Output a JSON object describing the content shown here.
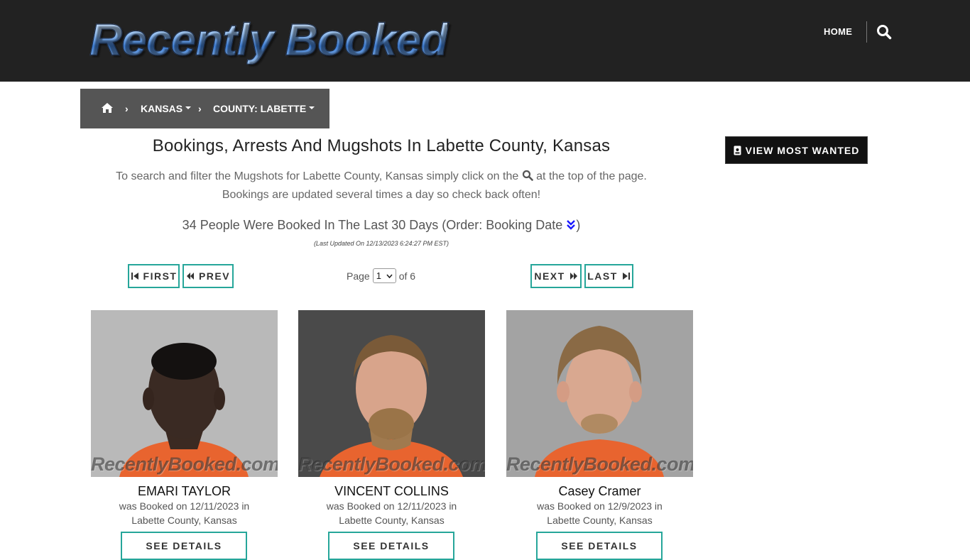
{
  "header": {
    "logo_text": "Recently Booked",
    "nav_home": "HOME"
  },
  "breadcrumb": {
    "state": "KANSAS",
    "county": "COUNTY: LABETTE"
  },
  "main": {
    "title": "Bookings, Arrests And Mugshots In Labette County, Kansas",
    "intro_line1_pre": "To search and filter the Mugshots for Labette County, Kansas simply click on the",
    "intro_line1_post": "at the top of the page.",
    "intro_line2": "Bookings are updated several times a day so check back often!",
    "count_text": "34 People Were Booked In The Last 30 Days (Order: Booking Date",
    "count_close": ")",
    "last_updated": "(Last Updated On 12/13/2023 6:24:27 PM EST)"
  },
  "pagination": {
    "first": "FIRST",
    "prev": "PREV",
    "next": "NEXT",
    "last": "LAST",
    "page_label": "Page",
    "current_page": "1",
    "of_label": "of 6"
  },
  "sidebar": {
    "most_wanted": "VIEW MOST WANTED"
  },
  "watermark": "RecentlyBooked.com",
  "cards": [
    {
      "name": "EMARI TAYLOR",
      "booked": "was Booked on 12/11/2023 in Labette County, Kansas",
      "button": "SEE DETAILS"
    },
    {
      "name": "VINCENT COLLINS",
      "booked": "was Booked on 12/11/2023 in Labette County, Kansas",
      "button": "SEE DETAILS"
    },
    {
      "name": "Casey Cramer",
      "booked": "was Booked on 12/9/2023 in Labette County, Kansas",
      "button": "SEE DETAILS"
    }
  ],
  "colors": {
    "header_bg": "#222222",
    "breadcrumb_bg": "#555555",
    "button_border": "#26a69a",
    "most_wanted_bg": "#111111"
  }
}
